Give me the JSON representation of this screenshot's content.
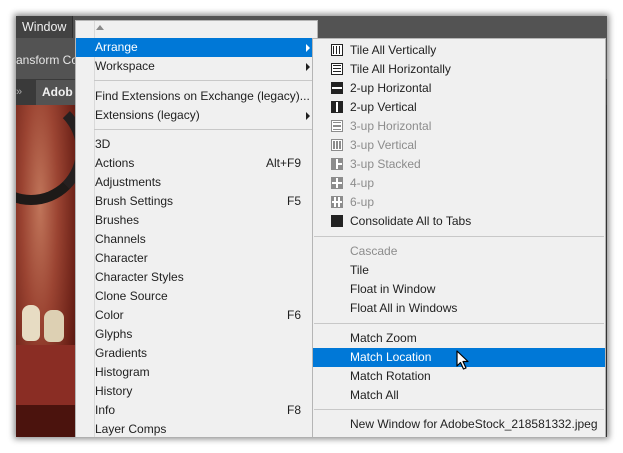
{
  "menubar": {
    "window_label": "Window"
  },
  "options_bar": {
    "partial_label": "ansform Co"
  },
  "doc_tab": {
    "label": "Adob"
  },
  "main_menu": {
    "items": [
      {
        "label": "Arrange",
        "shortcut": "",
        "submenu": true,
        "highlighted": true
      },
      {
        "label": "Workspace",
        "shortcut": "",
        "submenu": true
      },
      {
        "label": "Find Extensions on Exchange (legacy)...",
        "shortcut": "",
        "submenu": false
      },
      {
        "label": "Extensions (legacy)",
        "shortcut": "",
        "submenu": true
      },
      {
        "label": "3D",
        "shortcut": ""
      },
      {
        "label": "Actions",
        "shortcut": "Alt+F9"
      },
      {
        "label": "Adjustments",
        "shortcut": ""
      },
      {
        "label": "Brush Settings",
        "shortcut": "F5"
      },
      {
        "label": "Brushes",
        "shortcut": ""
      },
      {
        "label": "Channels",
        "shortcut": ""
      },
      {
        "label": "Character",
        "shortcut": ""
      },
      {
        "label": "Character Styles",
        "shortcut": ""
      },
      {
        "label": "Clone Source",
        "shortcut": ""
      },
      {
        "label": "Color",
        "shortcut": "F6"
      },
      {
        "label": "Glyphs",
        "shortcut": ""
      },
      {
        "label": "Gradients",
        "shortcut": ""
      },
      {
        "label": "Histogram",
        "shortcut": ""
      },
      {
        "label": "History",
        "shortcut": ""
      },
      {
        "label": "Info",
        "shortcut": "F8"
      },
      {
        "label": "Layer Comps",
        "shortcut": ""
      }
    ]
  },
  "arrange_menu": {
    "items": [
      {
        "label": "Tile All Vertically",
        "icon": "tile-vertical-icon",
        "disabled": false
      },
      {
        "label": "Tile All Horizontally",
        "icon": "tile-horizontal-icon",
        "disabled": false
      },
      {
        "label": "2-up Horizontal",
        "icon": "two-up-horizontal-icon",
        "disabled": false
      },
      {
        "label": "2-up Vertical",
        "icon": "two-up-vertical-icon",
        "disabled": false
      },
      {
        "label": "3-up Horizontal",
        "icon": "three-up-horizontal-icon",
        "disabled": true
      },
      {
        "label": "3-up Vertical",
        "icon": "three-up-vertical-icon",
        "disabled": true
      },
      {
        "label": "3-up Stacked",
        "icon": "three-up-stacked-icon",
        "disabled": true
      },
      {
        "label": "4-up",
        "icon": "four-up-icon",
        "disabled": true
      },
      {
        "label": "6-up",
        "icon": "six-up-icon",
        "disabled": true
      },
      {
        "label": "Consolidate All to Tabs",
        "icon": "consolidate-tabs-icon",
        "disabled": false
      },
      {
        "label": "Cascade",
        "disabled": true
      },
      {
        "label": "Tile",
        "disabled": false
      },
      {
        "label": "Float in Window",
        "disabled": false
      },
      {
        "label": "Float All in Windows",
        "disabled": false
      },
      {
        "label": "Match Zoom",
        "disabled": false
      },
      {
        "label": "Match Location",
        "disabled": false,
        "highlighted": true
      },
      {
        "label": "Match Rotation",
        "disabled": false
      },
      {
        "label": "Match All",
        "disabled": false
      },
      {
        "label": "New Window for AdobeStock_218581332.jpeg",
        "disabled": false
      }
    ]
  },
  "colors": {
    "highlight": "#0078d7",
    "menu_bg": "#f0f0f0",
    "disabled_text": "#8c8c8c",
    "app_chrome": "#535353"
  }
}
